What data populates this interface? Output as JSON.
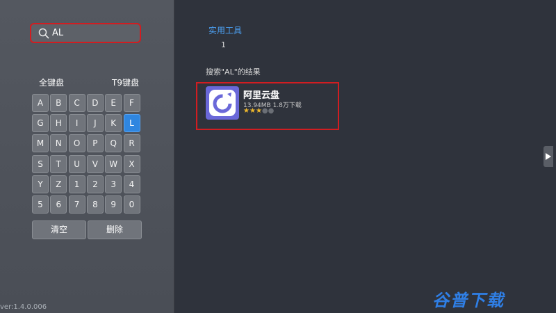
{
  "search": {
    "value": "AL"
  },
  "keyboard": {
    "tab_full": "全键盘",
    "tab_t9": "T9键盘",
    "rows": [
      [
        "A",
        "B",
        "C",
        "D",
        "E",
        "F"
      ],
      [
        "G",
        "H",
        "I",
        "J",
        "K",
        "L"
      ],
      [
        "M",
        "N",
        "O",
        "P",
        "Q",
        "R"
      ],
      [
        "S",
        "T",
        "U",
        "V",
        "W",
        "X"
      ],
      [
        "Y",
        "Z",
        "1",
        "2",
        "3",
        "4"
      ],
      [
        "5",
        "6",
        "7",
        "8",
        "9",
        "0"
      ]
    ],
    "selected": "L",
    "clear_label": "清空",
    "delete_label": "删除"
  },
  "version": "ver:1.4.0.006",
  "category": {
    "label": "实用工具",
    "count": "1"
  },
  "results": {
    "header": "搜索\"AL\"的结果",
    "items": [
      {
        "name": "阿里云盘",
        "meta": "13.94MB 1.8万下载",
        "rating": 3,
        "max_rating": 5
      }
    ]
  },
  "watermark": "谷普下载",
  "colors": {
    "accent": "#2f86e0",
    "highlight": "#d11d21",
    "star": "#f0b92c"
  }
}
